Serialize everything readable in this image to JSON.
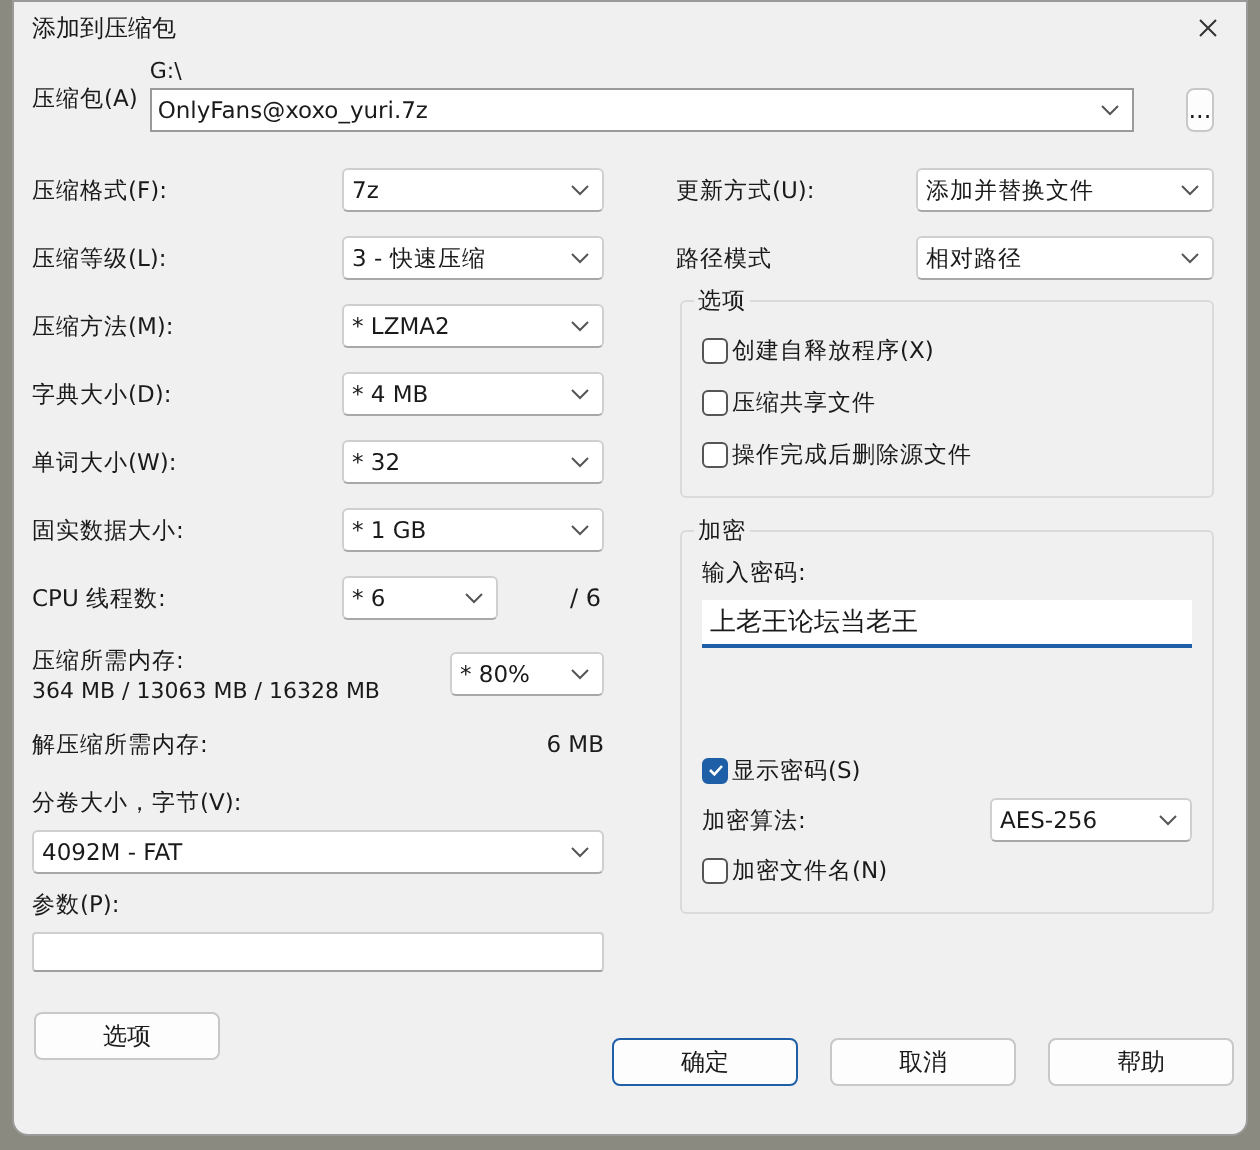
{
  "window": {
    "title": "添加到压缩包"
  },
  "archive": {
    "label": "压缩包(A)",
    "folder": "G:\\",
    "name": "OnlyFans@xoxo_yuri.7z",
    "browse": "..."
  },
  "left_rows": [
    {
      "kind": "select",
      "label": "压缩格式(F):",
      "value": "7z"
    },
    {
      "kind": "select",
      "label": "压缩等级(L):",
      "value": "3 - 快速压缩"
    },
    {
      "kind": "select",
      "label": "压缩方法(M):",
      "value": "*  LZMA2"
    },
    {
      "kind": "select",
      "label": "字典大小(D):",
      "value": "*  4 MB"
    },
    {
      "kind": "select",
      "label": "单词大小(W):",
      "value": "*  32"
    },
    {
      "kind": "select",
      "label": "固实数据大小:",
      "value": "*  1 GB"
    },
    {
      "kind": "threads",
      "label": "CPU 线程数:",
      "value": "*  6",
      "suffix": "/ 6"
    },
    {
      "kind": "memory",
      "label": "压缩所需内存:",
      "detail": "364 MB / 13063 MB / 16328 MB",
      "value": "*  80%"
    },
    {
      "kind": "info",
      "label": "解压缩所需内存:",
      "value": "6 MB"
    },
    {
      "kind": "wide",
      "label": "分卷大小，字节(V):",
      "value": "4092M - FAT"
    },
    {
      "kind": "input",
      "label": "参数(P):"
    }
  ],
  "options_button": "选项",
  "right_rows": [
    {
      "label": "更新方式(U):",
      "value": "添加并替换文件"
    },
    {
      "label": "路径模式",
      "value": "相对路径"
    }
  ],
  "options_group": {
    "title": "选项",
    "checkboxes": [
      {
        "label": "创建自释放程序(X)",
        "checked": false
      },
      {
        "label": "压缩共享文件",
        "checked": false
      },
      {
        "label": "操作完成后删除源文件",
        "checked": false
      }
    ]
  },
  "encryption": {
    "title": "加密",
    "password_label": "输入密码:",
    "password": "上老王论坛当老王",
    "show_password": {
      "label": "显示密码(S)",
      "checked": true
    },
    "method_label": "加密算法:",
    "method": "AES-256",
    "encrypt_names": {
      "label": "加密文件名(N)",
      "checked": false
    }
  },
  "buttons": [
    {
      "label": "确定",
      "default": true
    },
    {
      "label": "取消",
      "default": false
    },
    {
      "label": "帮助",
      "default": false
    }
  ]
}
